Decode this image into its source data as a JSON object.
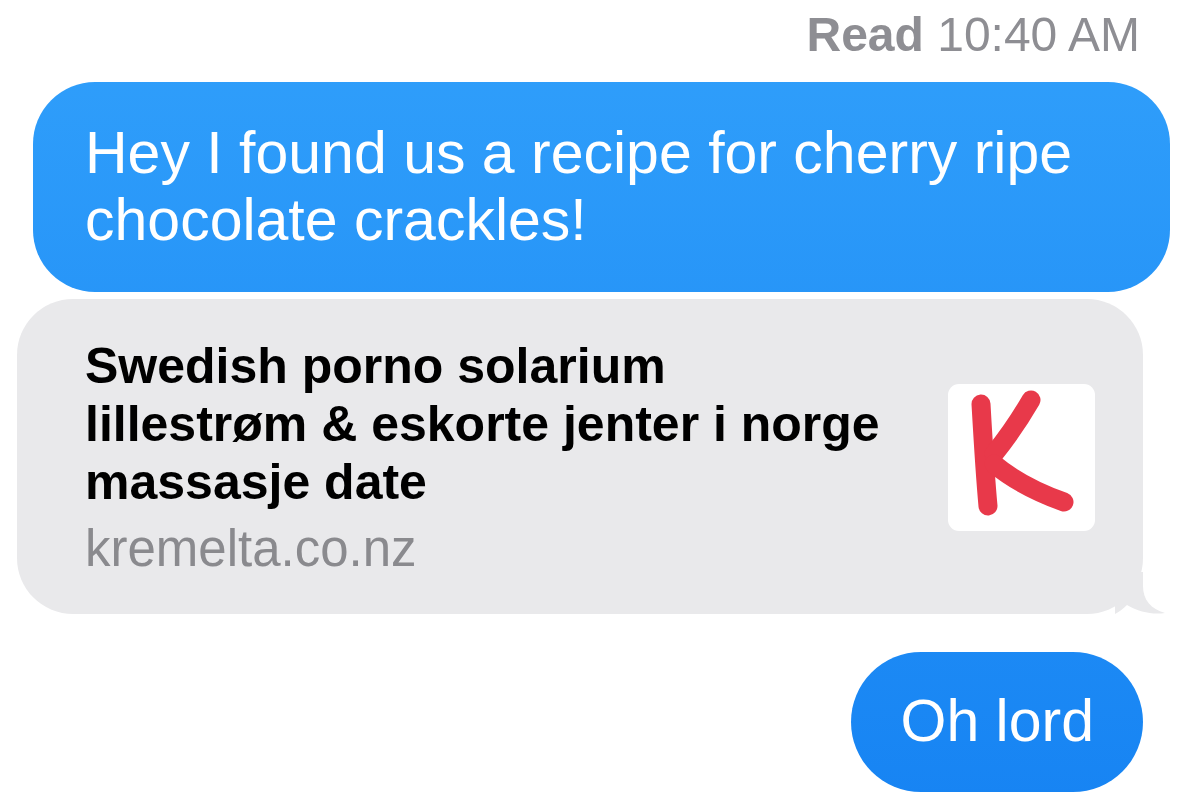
{
  "receipt": {
    "text": "**Read** 10:40 AM"
  },
  "messages": [
    {
      "kind": "text",
      "text": "Hey I found us a recipe for cherry ripe chocolate crackles!"
    },
    {
      "kind": "link",
      "title": "Swedish porno solarium\nlillestrøm & eskorte jenter i norge\nmassasje date",
      "domain": "kremelta.co.nz"
    },
    {
      "kind": "text",
      "text": "Oh lord"
    }
  ]
}
